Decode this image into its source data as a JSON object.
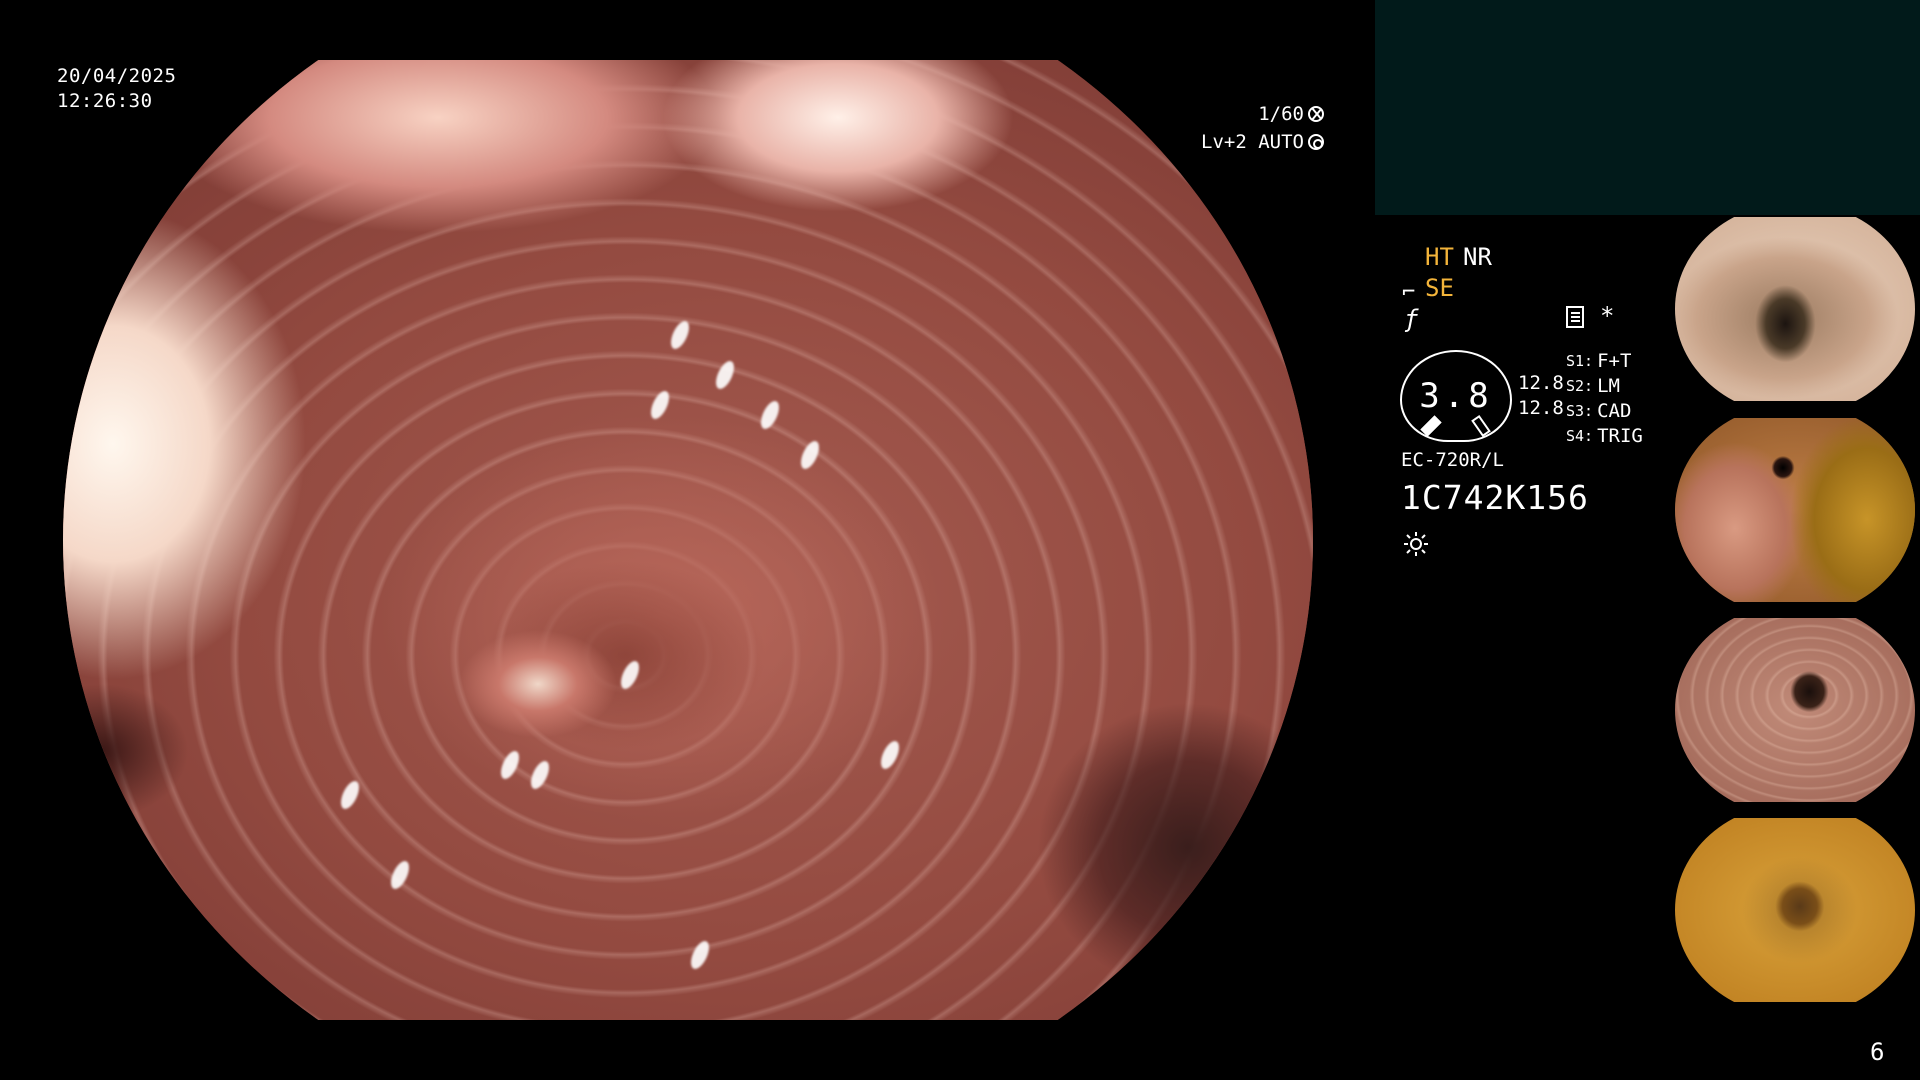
{
  "overlay": {
    "date": "20/04/2025",
    "time": "12:26:30",
    "shutter": "1/60",
    "light_mode": "Lv+2 AUTO"
  },
  "status": {
    "ht": "HT",
    "nr": "NR",
    "se": "SE",
    "gauge_value": "3.8",
    "level_1": "12.8",
    "level_2": "12.8",
    "settings": [
      {
        "key": "S1:",
        "value": "F+T"
      },
      {
        "key": "S2:",
        "value": "LM"
      },
      {
        "key": "S3:",
        "value": "CAD"
      },
      {
        "key": "S4:",
        "value": "TRIG"
      }
    ],
    "star": "*",
    "model": "EC-720R/L",
    "serial": "1C742K156"
  },
  "colors": {
    "accent_yellow": "#f3b43a",
    "info_box": "#011a1a"
  },
  "page_number": "6"
}
